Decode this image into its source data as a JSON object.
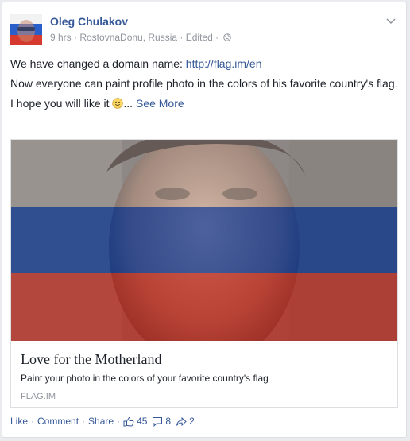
{
  "post": {
    "author": "Oleg Chulakov",
    "meta": "9 hrs · RostovnaDonu, Russia · Edited ·",
    "icons": {
      "avatar": "profile-photo-flag-overlay",
      "privacy": "globe-icon",
      "options": "chevron-down-icon"
    },
    "text": {
      "line1_prefix": "We have changed a domain name: ",
      "line1_link": "http://flag.im/en",
      "line2": "Now everyone can paint profile photo in the colors of his favorite country's flag.",
      "line3_prefix": "I hope you will like it ",
      "line3_ellipsis": "...",
      "see_more": "See More"
    }
  },
  "attachment": {
    "title": "Love for the Motherland",
    "description": "Paint your photo in the colors of your favorite country's flag",
    "domain": "FLAG.IM",
    "flag_colors": [
      "#ffffff",
      "#0039a6",
      "#d52b1e"
    ]
  },
  "actions": {
    "like": "Like",
    "comment": "Comment",
    "share": "Share",
    "likes_count": "45",
    "comments_count": "8",
    "shares_count": "2"
  },
  "colors": {
    "link": "#365899",
    "meta": "#90949c",
    "text": "#1d2129"
  }
}
